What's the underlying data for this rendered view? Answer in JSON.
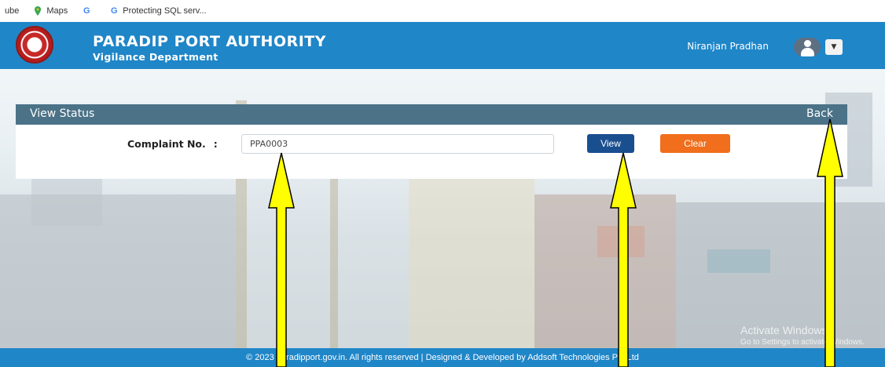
{
  "bookmarks": {
    "items": [
      {
        "label": "ube",
        "icon": "youtube-icon"
      },
      {
        "label": "Maps",
        "icon": "maps-icon"
      },
      {
        "label": "",
        "icon": "google-icon"
      },
      {
        "label": "Protecting SQL serv...",
        "icon": "google-icon"
      }
    ]
  },
  "header": {
    "org_name": "PARADIP PORT AUTHORITY",
    "department": "Vigilance Department",
    "user_name": "Niranjan Pradhan",
    "brand_color": "#1f86c8"
  },
  "panel": {
    "title": "View Status",
    "back_label": "Back",
    "field_label": "Complaint No.",
    "field_colon": ":",
    "complaint_value": "PPA0003",
    "view_label": "View",
    "clear_label": "Clear",
    "header_color": "#4b7287",
    "view_color": "#1a4f8f",
    "clear_color": "#f06e1c"
  },
  "footer": {
    "text": "© 2023 paradipport.gov.in. All rights reserved | Designed & Developed by Addsoft Technologies Pvt.Ltd"
  },
  "watermark": {
    "line1": "Activate Windows",
    "line2": "Go to Settings to activate Windows."
  },
  "annotations": {
    "arrow_color": "#ffff00"
  }
}
